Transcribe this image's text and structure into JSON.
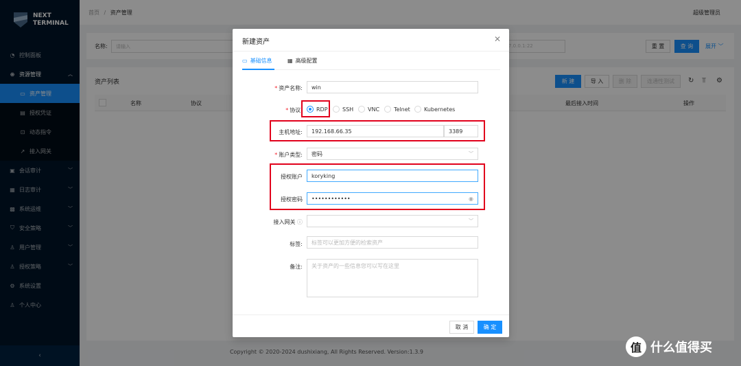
{
  "brand": {
    "line1": "NEXT",
    "line2": "TERMINAL"
  },
  "sidebar": {
    "items": [
      {
        "label": "控制面板",
        "icon": "dashboard-icon"
      },
      {
        "label": "资源管理",
        "icon": "cluster-icon",
        "open": true,
        "children": [
          {
            "label": "资产管理",
            "icon": "desktop-icon",
            "active": true
          },
          {
            "label": "授权凭证",
            "icon": "credential-icon"
          },
          {
            "label": "动态指令",
            "icon": "code-icon"
          },
          {
            "label": "接入网关",
            "icon": "gateway-icon"
          }
        ]
      },
      {
        "label": "会话审计",
        "icon": "audit-icon"
      },
      {
        "label": "日志审计",
        "icon": "log-icon"
      },
      {
        "label": "系统运维",
        "icon": "ops-icon"
      },
      {
        "label": "安全策略",
        "icon": "shield-icon"
      },
      {
        "label": "用户管理",
        "icon": "user-icon"
      },
      {
        "label": "授权策略",
        "icon": "policy-icon"
      },
      {
        "label": "系统设置",
        "icon": "gear-icon"
      },
      {
        "label": "个人中心",
        "icon": "profile-icon"
      }
    ],
    "collapse": "‹"
  },
  "header": {
    "crumb_home": "首页",
    "crumb_sep": "/",
    "crumb_current": "资产管理",
    "user": "超级管理员"
  },
  "search": {
    "name_label": "名称:",
    "name_placeholder": "请输入",
    "ip_placeholder": "7.0.0.1:22",
    "reset": "重 置",
    "query": "查 询",
    "expand": "展开"
  },
  "list": {
    "title": "资产列表",
    "buttons": {
      "new": "新 建",
      "import": "导 入",
      "delete": "删 除",
      "test": "连通性测试"
    },
    "columns": [
      "名称",
      "协议",
      "最后接入时间",
      "操作"
    ]
  },
  "footer": "Copyright © 2020-2024 dushixiang, All Rights Reserved. Version:1.3.9",
  "modal": {
    "title": "新建资产",
    "tabs": [
      "基础信息",
      "高级配置"
    ],
    "fields": {
      "name": {
        "label": "资产名称:",
        "value": "win"
      },
      "protocol": {
        "label": "协议:",
        "options": [
          "RDP",
          "SSH",
          "VNC",
          "Telnet",
          "Kubernetes"
        ],
        "selected": "RDP"
      },
      "host": {
        "label": "主机地址:",
        "ip": "192.168.66.35",
        "port": "3389"
      },
      "account_type": {
        "label": "账户类型:",
        "value": "密码"
      },
      "username": {
        "label": "授权账户",
        "value": "koryking"
      },
      "password": {
        "label": "授权密码",
        "value": "••••••••••••"
      },
      "gateway": {
        "label": "接入网关",
        "value": ""
      },
      "tags": {
        "label": "标签:",
        "placeholder": "标签可以更加方便的检索资产"
      },
      "remark": {
        "label": "备注:",
        "placeholder": "关于资产的一些信息您可以写在这里"
      }
    },
    "cancel": "取 消",
    "ok": "确 定"
  },
  "watermark": {
    "icon": "值",
    "text": "什么值得买"
  }
}
